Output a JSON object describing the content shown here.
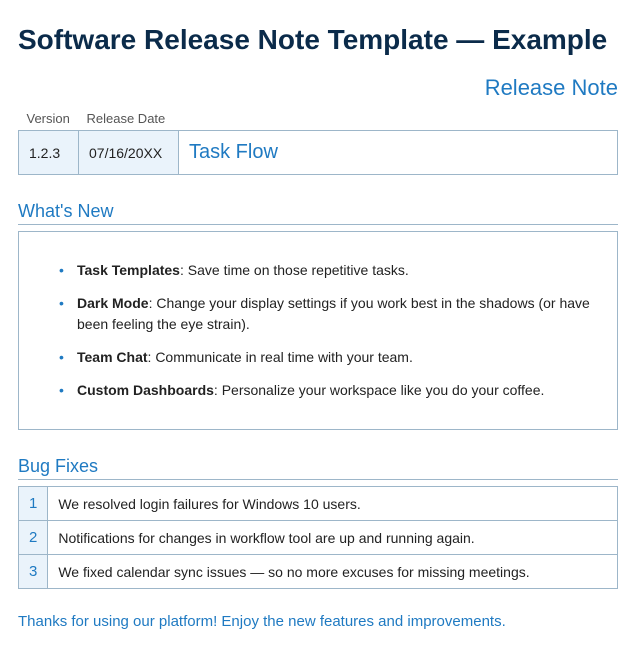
{
  "page_title": "Software Release Note Template — Example",
  "subtitle": "Release Note",
  "meta": {
    "headers": {
      "version": "Version",
      "release_date": "Release Date"
    },
    "version": "1.2.3",
    "release_date": "07/16/20XX",
    "product": "Task Flow"
  },
  "whats_new": {
    "heading": "What's New",
    "items": [
      {
        "name": "Task Templates",
        "desc": ": Save time on those repetitive tasks."
      },
      {
        "name": "Dark Mode",
        "desc": ": Change your display settings if you work best in the shadows (or have been feeling the eye strain)."
      },
      {
        "name": "Team Chat",
        "desc": ": Communicate in real time with your team."
      },
      {
        "name": "Custom Dashboards",
        "desc": ": Personalize your workspace like you do your coffee."
      }
    ]
  },
  "bug_fixes": {
    "heading": "Bug Fixes",
    "items": [
      "We resolved login failures for Windows 10 users.",
      "Notifications for changes in workflow tool are up and running again.",
      "We fixed calendar sync issues — so no more excuses for missing meetings."
    ]
  },
  "closing": "Thanks for using our platform! Enjoy the new features and improvements."
}
